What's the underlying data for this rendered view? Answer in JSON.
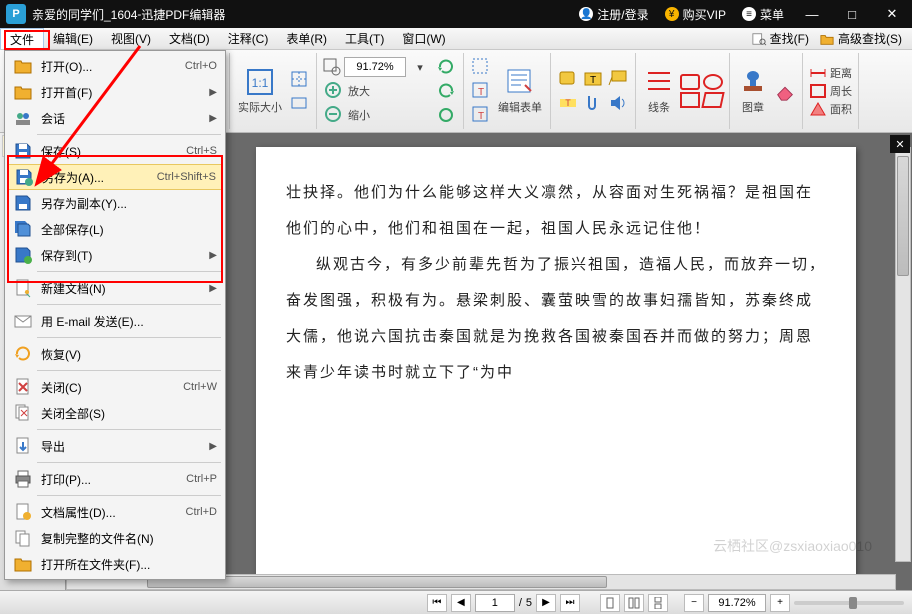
{
  "title": {
    "doc": "亲爱的同学们_1604",
    "sep": " - ",
    "app": "迅捷PDF编辑器",
    "icon": "P"
  },
  "titlebar_right": {
    "login": "注册/登录",
    "vip": "购买VIP",
    "menu": "菜单",
    "user_glyph": "👤",
    "vip_glyph": "¥",
    "menu_glyph": "≡"
  },
  "win": {
    "min": "—",
    "max": "□",
    "close": "✕"
  },
  "menubar": [
    "文件",
    "编辑(E)",
    "视图(V)",
    "文档(D)",
    "注释(C)",
    "表单(R)",
    "工具(T)",
    "窗口(W)"
  ],
  "menubar_right": {
    "find": "查找(F)",
    "adv": "高级查找(S)"
  },
  "ribbon": {
    "zoom_value": "91.72%",
    "g1": {
      "actual": "实际大小"
    },
    "g2": {
      "zoomin": "放大",
      "zoomout": "缩小"
    },
    "g3": {
      "label": "编辑表单"
    },
    "g4": {
      "label": "线条"
    },
    "g5": {
      "label": "图章"
    },
    "g6": {
      "dist": "距离",
      "perim": "周长",
      "area": "面积"
    }
  },
  "dropdown": {
    "open": {
      "label": "打开(O)...",
      "shortcut": "Ctrl+O"
    },
    "open_dir": {
      "label": "打开首(F)"
    },
    "session": {
      "label": "会话"
    },
    "save": {
      "label": "保存(S)",
      "shortcut": "Ctrl+S"
    },
    "saveas": {
      "label": "另存为(A)...",
      "shortcut": "Ctrl+Shift+S"
    },
    "savecopy": {
      "label": "另存为副本(Y)..."
    },
    "saveall": {
      "label": "全部保存(L)"
    },
    "saveto": {
      "label": "保存到(T)"
    },
    "newdoc": {
      "label": "新建文档(N)"
    },
    "email": {
      "label": "用 E-mail 发送(E)..."
    },
    "recover": {
      "label": "恢复(V)"
    },
    "close": {
      "label": "关闭(C)",
      "shortcut": "Ctrl+W"
    },
    "closeall": {
      "label": "关闭全部(S)"
    },
    "export": {
      "label": "导出"
    },
    "print": {
      "label": "打印(P)...",
      "shortcut": "Ctrl+P"
    },
    "props": {
      "label": "文档属性(D)...",
      "shortcut": "Ctrl+D"
    },
    "copyname": {
      "label": "复制完整的文件名(N)"
    },
    "openloc": {
      "label": "打开所在文件夹(F)..."
    }
  },
  "doc": {
    "p1": "壮抉择。他们为什么能够这样大义凛然，从容面对生死祸福？是祖国在他们的心中，他们和祖国在一起，祖国人民永远记住他！",
    "p2": "纵观古今，有多少前辈先哲为了振兴祖国，造福人民，而放弃一切，奋发图强，积极有为。悬梁刺股、囊萤映雪的故事妇孺皆知，苏秦终成大儒，他说六国抗击秦国就是为挽救各国被秦国吞并而做的努力；周恩来青少年读书时就立下了“为中"
  },
  "status": {
    "page_cur": "1",
    "page_sep": "/",
    "page_total": "5",
    "zoom": "91.72%",
    "first": "⏮",
    "prev": "◀",
    "next": "▶",
    "last": "⏭",
    "minus": "−",
    "plus": "+"
  },
  "watermark": "云栖社区@zsxiaoxiao010",
  "icons": {
    "folder": "#f0a020",
    "save": "#3878c8",
    "close": "#c04040"
  }
}
